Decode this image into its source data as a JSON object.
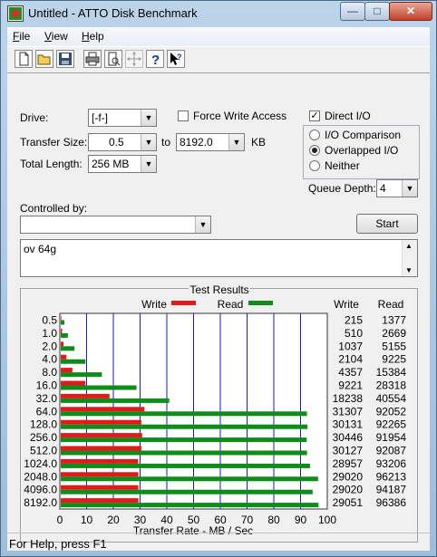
{
  "window": {
    "title": "Untitled - ATTO Disk Benchmark",
    "min_glyph": "—",
    "max_glyph": "□",
    "close_glyph": "✕"
  },
  "menu": [
    {
      "label": "File",
      "underline_index": 0
    },
    {
      "label": "View",
      "underline_index": 0
    },
    {
      "label": "Help",
      "underline_index": 0
    }
  ],
  "toolbar": {
    "icons": [
      "new-file-icon",
      "open-folder-icon",
      "save-icon",
      "print-icon",
      "print-preview-icon",
      "move-icon",
      "help-icon",
      "context-help-icon"
    ]
  },
  "settings": {
    "drive_label": "Drive:",
    "drive_value": "[-f-]",
    "force_write_label": "Force Write Access",
    "force_write_checked": false,
    "direct_io_label": "Direct I/O",
    "direct_io_checked": true,
    "transfer_size_label": "Transfer Size:",
    "transfer_from": "0.5",
    "to_label": "to",
    "transfer_to": "8192.0",
    "kb_label": "KB",
    "total_length_label": "Total Length:",
    "total_length_value": "256 MB",
    "io_mode_options": [
      "I/O Comparison",
      "Overlapped I/O",
      "Neither"
    ],
    "io_mode_selected": "Overlapped I/O",
    "queue_depth_label": "Queue Depth:",
    "queue_depth_value": "4",
    "controlled_by_label": "Controlled by:",
    "controlled_by_value": "",
    "start_button": "Start",
    "notes_text": "ov 64g"
  },
  "results": {
    "title": "Test Results",
    "write_header": "Write",
    "read_header": "Read"
  },
  "chart_data": {
    "type": "bar",
    "orientation": "horizontal",
    "categories": [
      "0.5",
      "1.0",
      "2.0",
      "4.0",
      "8.0",
      "16.0",
      "32.0",
      "64.0",
      "128.0",
      "256.0",
      "512.0",
      "1024.0",
      "2048.0",
      "4096.0",
      "8192.0"
    ],
    "series": [
      {
        "name": "Write",
        "color": "#e21a1a",
        "values": [
          215,
          510,
          1037,
          2104,
          4357,
          9221,
          18238,
          31307,
          30131,
          30446,
          30127,
          28957,
          29020,
          29020,
          29051
        ]
      },
      {
        "name": "Read",
        "color": "#0f8c1a",
        "values": [
          1377,
          2669,
          5155,
          9225,
          15384,
          28318,
          40554,
          92052,
          92265,
          91954,
          92087,
          93206,
          96213,
          94187,
          96386
        ]
      }
    ],
    "xlabel": "Transfer Rate - MB / Sec",
    "xlim": [
      0,
      100
    ],
    "xticks": [
      "0",
      "10",
      "20",
      "30",
      "40",
      "50",
      "60",
      "70",
      "80",
      "90",
      "100"
    ],
    "value_scale": 1000,
    "legend": "top",
    "grid": true
  },
  "status": {
    "text": "For Help, press F1"
  }
}
